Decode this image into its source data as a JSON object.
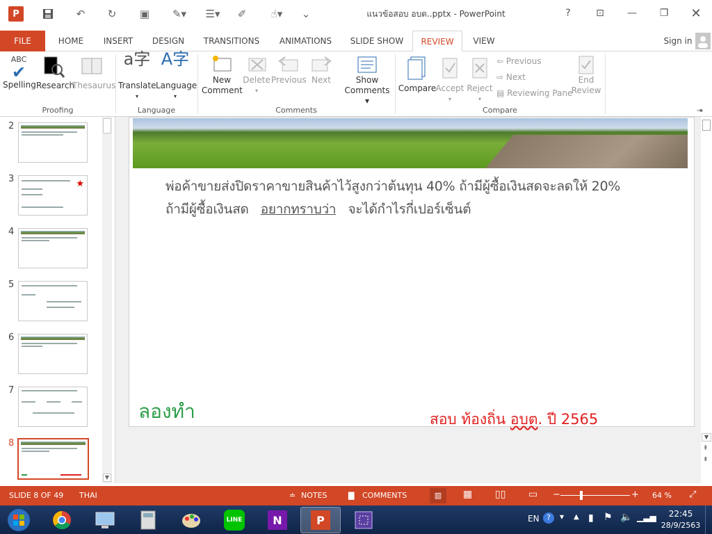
{
  "window": {
    "title": "แนวข้อสอบ อบต..pptx - PowerPoint",
    "help": "?",
    "sign_in": "Sign in"
  },
  "qat": {
    "save": "save-icon",
    "undo": "undo-icon",
    "redo": "redo-icon"
  },
  "tabs": [
    "FILE",
    "HOME",
    "INSERT",
    "DESIGN",
    "TRANSITIONS",
    "ANIMATIONS",
    "SLIDE SHOW",
    "REVIEW",
    "VIEW"
  ],
  "active_tab": "REVIEW",
  "ribbon": {
    "proofing": {
      "spelling": "Spelling",
      "research": "Research",
      "thesaurus": "Thesaurus",
      "group": "Proofing",
      "abc": "ABC"
    },
    "language": {
      "translate": "Translate",
      "language": "Language",
      "group": "Language"
    },
    "comments": {
      "new_comment_1": "New",
      "new_comment_2": "Comment",
      "delete": "Delete",
      "previous": "Previous",
      "next": "Next",
      "show_comments_1": "Show",
      "show_comments_2": "Comments",
      "group": "Comments"
    },
    "compare": {
      "compare": "Compare",
      "accept": "Accept",
      "reject": "Reject",
      "previous": "Previous",
      "next": "Next",
      "reviewing_pane": "Reviewing Pane",
      "end_review_1": "End",
      "end_review_2": "Review",
      "group": "Compare"
    }
  },
  "thumbnails": [
    {
      "num": "2"
    },
    {
      "num": "3"
    },
    {
      "num": "4"
    },
    {
      "num": "5"
    },
    {
      "num": "6"
    },
    {
      "num": "7"
    },
    {
      "num": "8"
    }
  ],
  "selected_slide": 8,
  "slide": {
    "line1": "พ่อค้าขายส่งปิดราคาขายสินค้าไว้สูงกว่าต้นทุน  40%  ถ้ามีผู้ซื้อเงินสดจะลดให้  20%",
    "line2_a": "ถ้ามีผู้ซื้อเงินสด",
    "line2_b": "อยากทราบว่า",
    "line2_c": "จะได้กำไรกี่เปอร์เซ็นต์",
    "try_label": "ลองทำ",
    "exam_a": "สอบ ท้องถิ่น ",
    "exam_b": "อบต",
    "exam_c": ". ปี 2565"
  },
  "status": {
    "slide_info": "SLIDE 8 OF 49",
    "language": "THAI",
    "notes": "NOTES",
    "comments": "COMMENTS",
    "zoom": "64 %"
  },
  "taskbar": {
    "lang": "EN",
    "time": "22:45",
    "date": "28/9/2563"
  },
  "colors": {
    "accent": "#d24726",
    "green_text": "#2e9e4a",
    "red_text": "#e02020",
    "taskbar": "#1c3560"
  }
}
